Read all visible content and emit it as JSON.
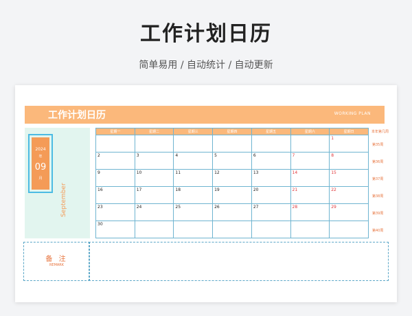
{
  "hero": {
    "title": "工作计划日历",
    "subtitle": "简单易用  /  自动统计  /  自动更新"
  },
  "banner": {
    "title": "工作计划日历",
    "subtitle_en": "WORKING PLAN"
  },
  "date_badge": {
    "year": "2024",
    "year_unit": "年",
    "month": "09",
    "month_unit": "月",
    "month_en": "September"
  },
  "calendar": {
    "weekdays": [
      "星期一",
      "星期二",
      "星期三",
      "星期四",
      "星期五",
      "星期六",
      "星期日"
    ],
    "weeks": [
      [
        "",
        "",
        "",
        "",
        "",
        "",
        "1"
      ],
      [
        "2",
        "3",
        "4",
        "5",
        "6",
        "7",
        "8"
      ],
      [
        "9",
        "10",
        "11",
        "12",
        "13",
        "14",
        "15"
      ],
      [
        "16",
        "17",
        "18",
        "19",
        "20",
        "21",
        "22"
      ],
      [
        "23",
        "24",
        "25",
        "26",
        "27",
        "28",
        "29"
      ],
      [
        "30",
        "",
        "",
        "",
        "",
        "",
        ""
      ]
    ],
    "weekend_color": "#e0373a",
    "accent_color": "#fbb87b"
  },
  "week_numbers": {
    "header": "本年第几周",
    "labels": [
      "第35周",
      "第36周",
      "第37周",
      "第38周",
      "第39周",
      "第40周"
    ]
  },
  "notes": {
    "label_cn": "备 注",
    "label_en": "REMARK"
  }
}
